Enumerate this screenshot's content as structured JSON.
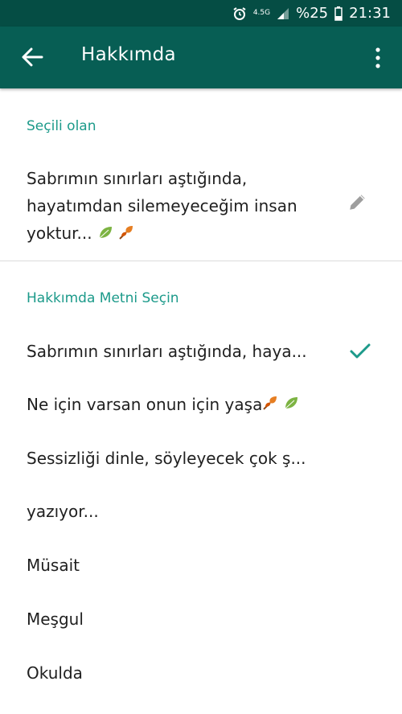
{
  "status_bar": {
    "network": "4.5G",
    "battery_text": "%25",
    "time": "21:31"
  },
  "app_bar": {
    "title": "Hakkımda",
    "back_icon": "arrow-left-icon",
    "menu_icon": "more-vertical-icon"
  },
  "current": {
    "label": "Seçili olan",
    "text": "Sabrımın sınırları aştığında, hayatımdan silemeyeceğim insan yoktur...",
    "emoji": [
      "leaf-icon",
      "autumn-leaf-icon"
    ]
  },
  "options": {
    "label": "Hakkımda Metni Seçin",
    "items": [
      {
        "text": "Sabrımın sınırları aştığında, haya...",
        "selected": true
      },
      {
        "text": "Ne için varsan onun için yaşa",
        "emoji": [
          "autumn-leaf-icon",
          "leaf-icon"
        ]
      },
      {
        "text": "Sessizliği dinle, söyleyecek çok ş..."
      },
      {
        "text": "yazıyor..."
      },
      {
        "text": "Müsait"
      },
      {
        "text": "Meşgul"
      },
      {
        "text": "Okulda"
      }
    ]
  },
  "colors": {
    "status_bar": "#054d44",
    "app_bar": "#075e54",
    "accent": "#1c9a8a"
  }
}
